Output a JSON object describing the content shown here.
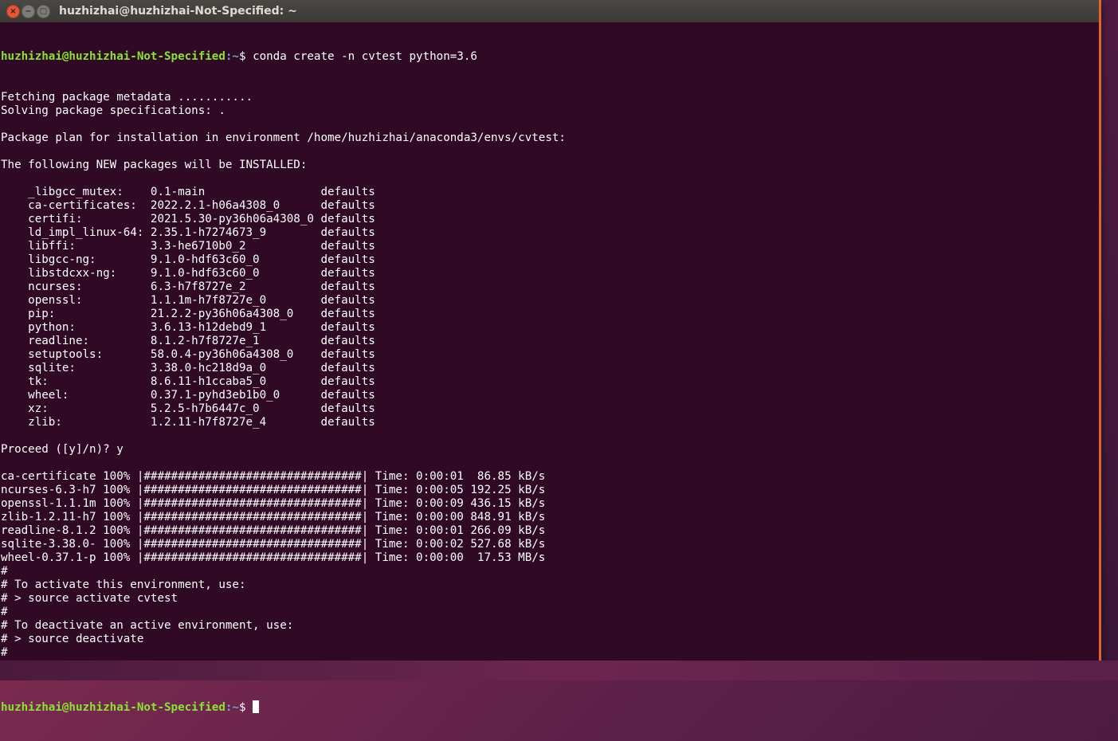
{
  "window": {
    "title": "huzhizhai@huzhizhai-Not-Specified: ~",
    "close_glyph": "×",
    "min_glyph": "−",
    "max_glyph": "▢"
  },
  "prompt": {
    "user_host": "huzhizhai@huzhizhai-Not-Specified",
    "path": ":~",
    "symbol": "$ "
  },
  "command": "conda create -n cvtest python=3.6",
  "output_lines": [
    "Fetching package metadata ...........",
    "Solving package specifications: .",
    "",
    "Package plan for installation in environment /home/huzhizhai/anaconda3/envs/cvtest:",
    "",
    "The following NEW packages will be INSTALLED:",
    "",
    "    _libgcc_mutex:    0.1-main                 defaults",
    "    ca-certificates:  2022.2.1-h06a4308_0      defaults",
    "    certifi:          2021.5.30-py36h06a4308_0 defaults",
    "    ld_impl_linux-64: 2.35.1-h7274673_9        defaults",
    "    libffi:           3.3-he6710b0_2           defaults",
    "    libgcc-ng:        9.1.0-hdf63c60_0         defaults",
    "    libstdcxx-ng:     9.1.0-hdf63c60_0         defaults",
    "    ncurses:          6.3-h7f8727e_2           defaults",
    "    openssl:          1.1.1m-h7f8727e_0        defaults",
    "    pip:              21.2.2-py36h06a4308_0    defaults",
    "    python:           3.6.13-h12debd9_1        defaults",
    "    readline:         8.1.2-h7f8727e_1         defaults",
    "    setuptools:       58.0.4-py36h06a4308_0    defaults",
    "    sqlite:           3.38.0-hc218d9a_0        defaults",
    "    tk:               8.6.11-h1ccaba5_0        defaults",
    "    wheel:            0.37.1-pyhd3eb1b0_0      defaults",
    "    xz:               5.2.5-h7b6447c_0         defaults",
    "    zlib:             1.2.11-h7f8727e_4        defaults",
    "",
    "Proceed ([y]/n)? y",
    "",
    "ca-certificate 100% |################################| Time: 0:00:01  86.85 kB/s",
    "ncurses-6.3-h7 100% |################################| Time: 0:00:05 192.25 kB/s",
    "openssl-1.1.1m 100% |################################| Time: 0:00:09 436.15 kB/s",
    "zlib-1.2.11-h7 100% |################################| Time: 0:00:00 848.91 kB/s",
    "readline-8.1.2 100% |################################| Time: 0:00:01 266.09 kB/s",
    "sqlite-3.38.0- 100% |################################| Time: 0:00:02 527.68 kB/s",
    "wheel-0.37.1-p 100% |################################| Time: 0:00:00  17.53 MB/s",
    "#",
    "# To activate this environment, use:",
    "# > source activate cvtest",
    "#",
    "# To deactivate an active environment, use:",
    "# > source deactivate",
    "#",
    ""
  ],
  "colors": {
    "terminal_bg": "#300a24",
    "prompt_user": "#8ae234",
    "prompt_path": "#729fcf",
    "text": "#ffffff"
  }
}
